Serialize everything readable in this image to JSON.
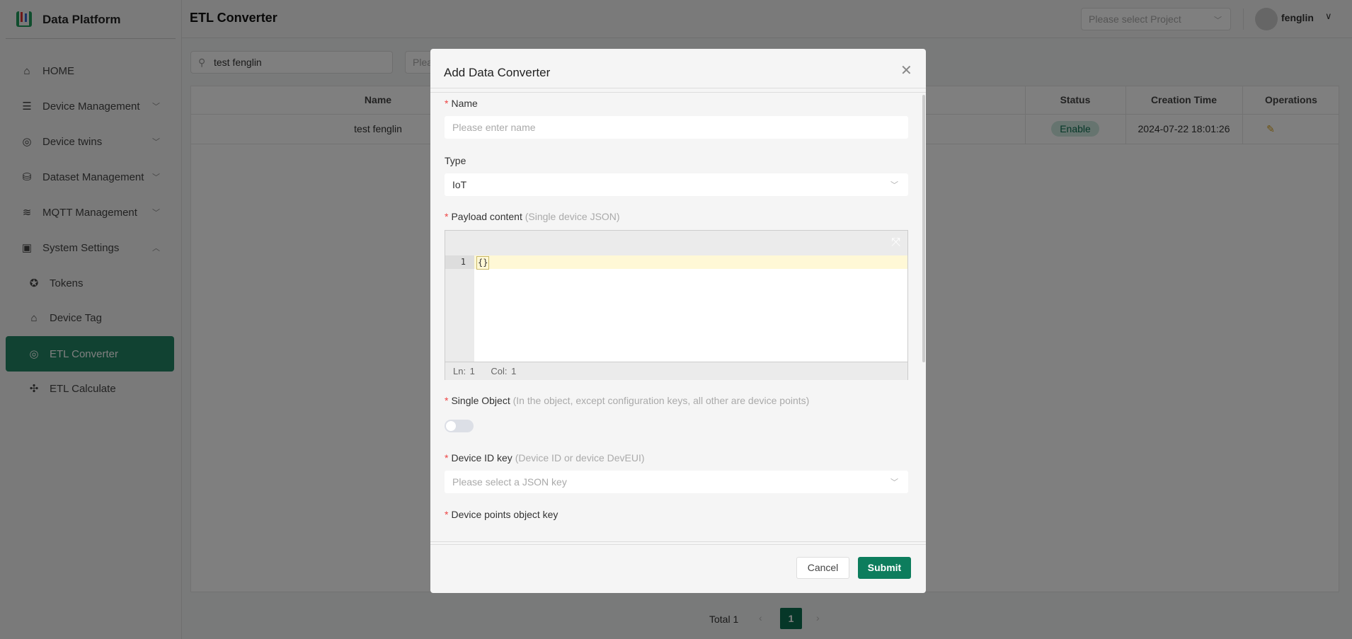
{
  "app": {
    "name": "Data Platform",
    "page_title": "ETL Converter"
  },
  "header": {
    "project_placeholder": "Please select Project",
    "user": "fenglin"
  },
  "sidebar": {
    "items": [
      {
        "label": "HOME",
        "icon": "home-icon"
      },
      {
        "label": "Device Management",
        "icon": "server-icon"
      },
      {
        "label": "Device twins",
        "icon": "twins-icon"
      },
      {
        "label": "Dataset Management",
        "icon": "database-icon"
      },
      {
        "label": "MQTT Management",
        "icon": "router-icon"
      },
      {
        "label": "System Settings",
        "icon": "monitor-icon"
      },
      {
        "label": "Tokens",
        "icon": "star-circle-icon"
      },
      {
        "label": "Device Tag",
        "icon": "tag-icon"
      },
      {
        "label": "ETL Converter",
        "icon": "converter-icon",
        "active": true
      },
      {
        "label": "ETL Calculate",
        "icon": "calculate-icon"
      }
    ]
  },
  "filters": {
    "search_value": "test fenglin",
    "second_placeholder": "Plea"
  },
  "table": {
    "columns": [
      "Name",
      "Status",
      "Creation Time",
      "Operations"
    ],
    "rows": [
      {
        "name": "test fenglin",
        "status": "Enable",
        "created": "2024-07-22 18:01:26",
        "operation_icon": "edit-icon"
      }
    ]
  },
  "pagination": {
    "total": "Total 1",
    "current": "1"
  },
  "modal": {
    "title": "Add Data Converter",
    "name_label": "Name",
    "name_placeholder": "Please enter name",
    "type_label": "Type",
    "type_value": "IoT",
    "payload_label": "Payload content",
    "payload_hint": "(Single device JSON)",
    "editor": {
      "line": "1",
      "code": "{}",
      "status_ln": "Ln: 1",
      "status_col": "Col: 1"
    },
    "single_label": "Single Object",
    "single_hint": "(In the object, except configuration keys, all other are device points)",
    "single_on": false,
    "devid_label": "Device ID key",
    "devid_hint": "(Device ID or device DevEUI)",
    "devid_placeholder": "Please select a JSON key",
    "points_label": "Device points object key",
    "cancel": "Cancel",
    "submit": "Submit"
  },
  "colors": {
    "accent": "#0d7d5d",
    "sidebar_active": "#228464"
  }
}
